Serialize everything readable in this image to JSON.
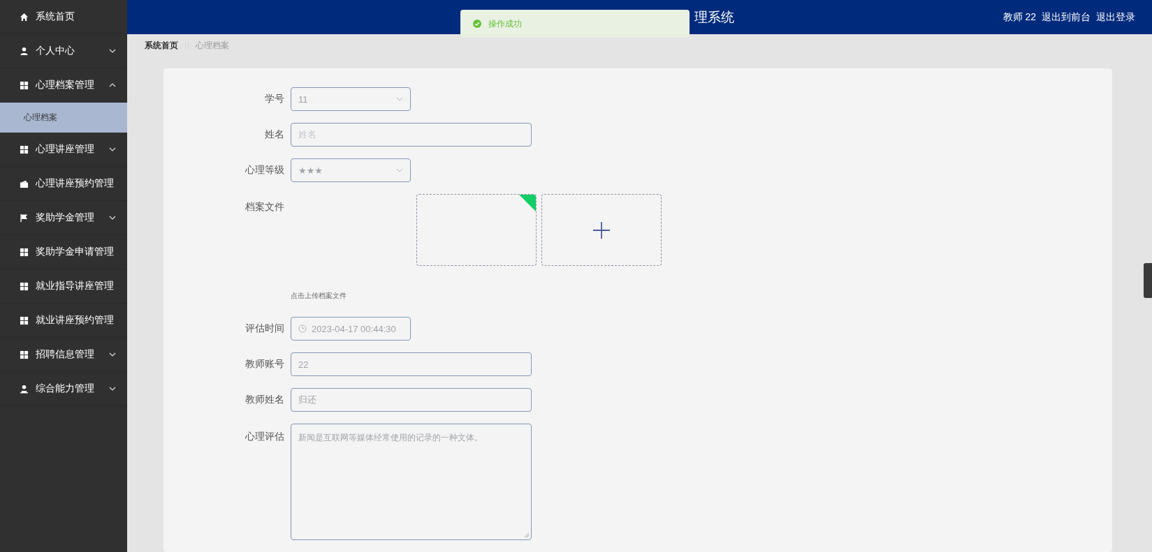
{
  "header": {
    "title": "理系统",
    "user": "教师 22",
    "links": [
      "退出到前台",
      "退出登录"
    ]
  },
  "toast": {
    "message": "操作成功"
  },
  "sidebar": {
    "items": [
      {
        "label": "系统首页",
        "kind": "link"
      },
      {
        "label": "个人中心",
        "kind": "group",
        "expanded": false
      },
      {
        "label": "心理档案管理",
        "kind": "group",
        "expanded": true,
        "children": [
          {
            "label": "心理档案",
            "selected": true
          }
        ]
      },
      {
        "label": "心理讲座管理",
        "kind": "group",
        "expanded": false
      },
      {
        "label": "心理讲座预约管理",
        "kind": "link"
      },
      {
        "label": "奖助学金管理",
        "kind": "group",
        "expanded": false
      },
      {
        "label": "奖助学金申请管理",
        "kind": "link"
      },
      {
        "label": "就业指导讲座管理",
        "kind": "link"
      },
      {
        "label": "就业讲座预约管理",
        "kind": "link"
      },
      {
        "label": "招聘信息管理",
        "kind": "group",
        "expanded": false
      },
      {
        "label": "综合能力管理",
        "kind": "group",
        "expanded": false
      }
    ]
  },
  "breadcrumb": [
    "系统首页",
    "心理档案"
  ],
  "form": {
    "fields": [
      {
        "label": "学号",
        "kind": "select",
        "value": "11"
      },
      {
        "label": "姓名",
        "kind": "text",
        "placeholder": "姓名"
      },
      {
        "label": "心理等级",
        "kind": "select",
        "value": "★★★"
      },
      {
        "label": "档案文件",
        "kind": "upload",
        "uploaded": true,
        "hint": "点击上传档案文件"
      },
      {
        "label": "评估时间",
        "kind": "datetime",
        "value": "2023-04-17 00:44:30"
      },
      {
        "label": "教师账号",
        "kind": "text",
        "value": "22"
      },
      {
        "label": "教师姓名",
        "kind": "text",
        "value": "归还"
      },
      {
        "label": "心理评估",
        "kind": "textarea",
        "value": "新闻是互联网等媒体经常使用的记录的一种文体。"
      }
    ]
  }
}
